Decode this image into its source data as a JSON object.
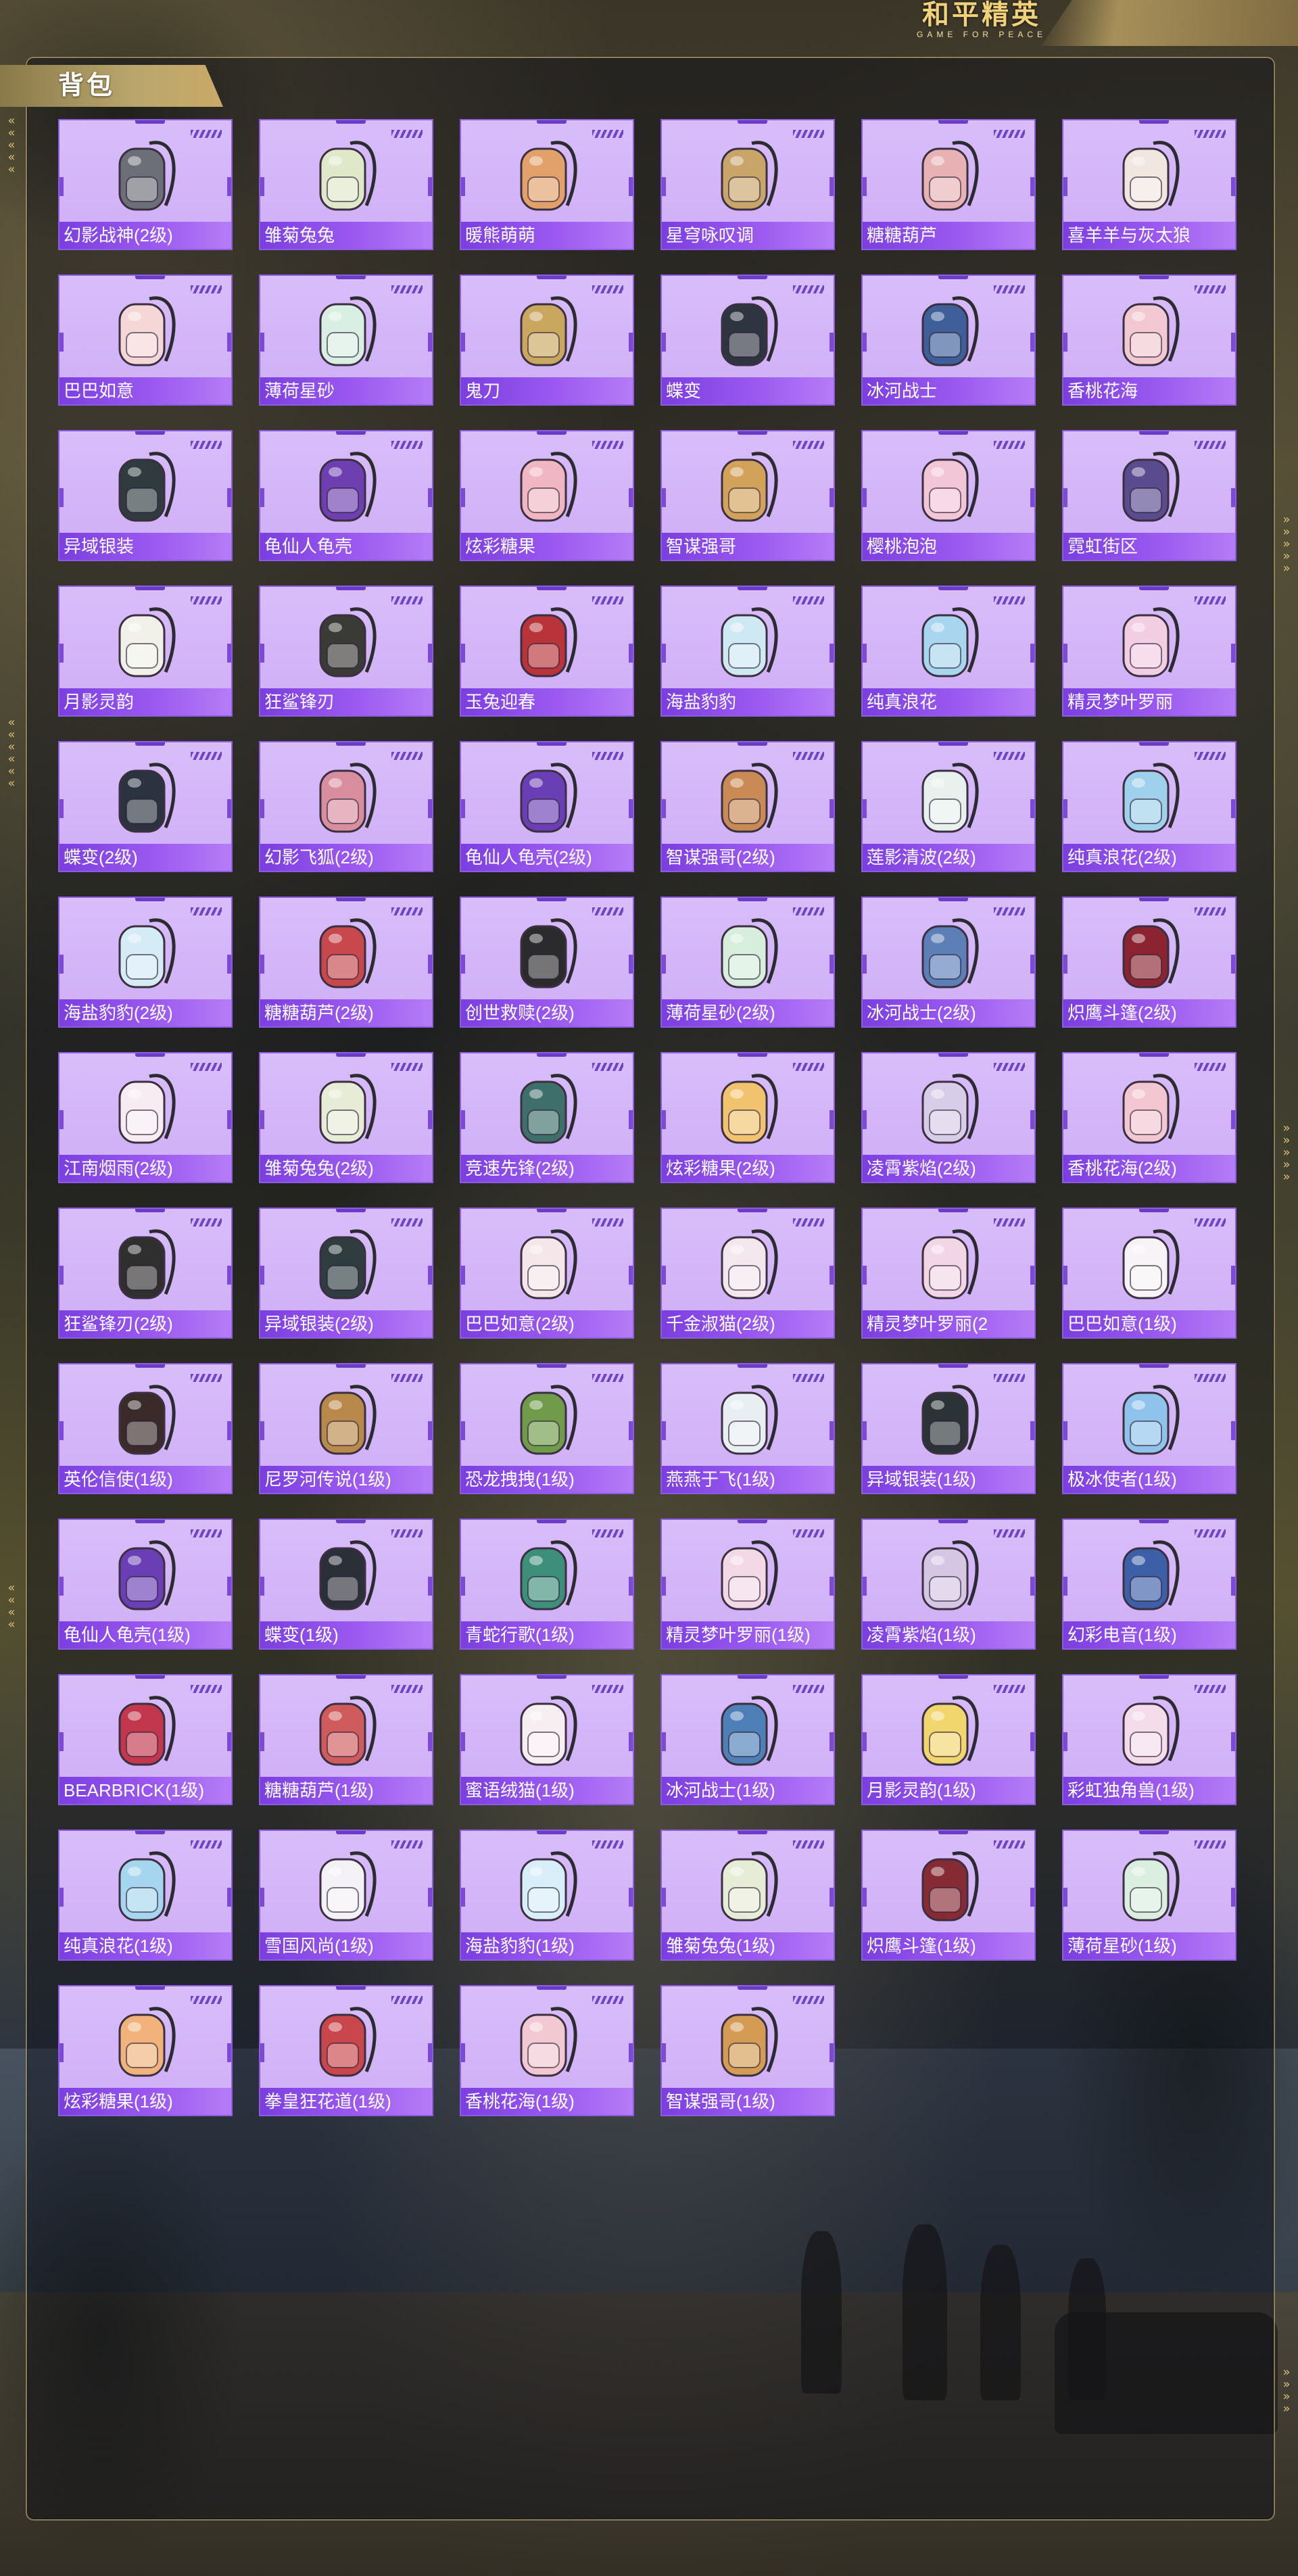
{
  "brand": {
    "title": "和平精英",
    "subtitle": "GAME FOR PEACE"
  },
  "panel": {
    "title": "背包"
  },
  "colors": {
    "card_bg": "#d8bdfa",
    "card_border": "#8c5de2",
    "label_bg": "#7b3fe0",
    "panel_frame": "#dcc88c"
  },
  "items": [
    {
      "name": "幻影战神(2级)",
      "color": "#6c6f78"
    },
    {
      "name": "雏菊兔兔",
      "color": "#dfe8c8"
    },
    {
      "name": "暖熊萌萌",
      "color": "#e2a06a"
    },
    {
      "name": "星穹咏叹调",
      "color": "#c9a56a"
    },
    {
      "name": "糖糖葫芦",
      "color": "#e8b2b4"
    },
    {
      "name": "喜羊羊与灰太狼",
      "color": "#f1e6e0"
    },
    {
      "name": "巴巴如意",
      "color": "#f6d7d8"
    },
    {
      "name": "薄荷星砂",
      "color": "#d9efe4"
    },
    {
      "name": "鬼刀",
      "color": "#c9a75e"
    },
    {
      "name": "蝶变",
      "color": "#2e3440"
    },
    {
      "name": "冰河战士",
      "color": "#3e5f9a"
    },
    {
      "name": "香桃花海",
      "color": "#f2c9d2"
    },
    {
      "name": "异域银装",
      "color": "#2f3b3e"
    },
    {
      "name": "龟仙人龟壳",
      "color": "#6d3fb0"
    },
    {
      "name": "炫彩糖果",
      "color": "#f0b7c3"
    },
    {
      "name": "智谋强哥",
      "color": "#d3a25a"
    },
    {
      "name": "樱桃泡泡",
      "color": "#f3c6d7"
    },
    {
      "name": "霓虹街区",
      "color": "#5a4b8f"
    },
    {
      "name": "月影灵韵",
      "color": "#f1f1ea"
    },
    {
      "name": "狂鲨锋刃",
      "color": "#3a3a36"
    },
    {
      "name": "玉兔迎春",
      "color": "#b8343a"
    },
    {
      "name": "海盐豹豹",
      "color": "#cfe9f4"
    },
    {
      "name": "纯真浪花",
      "color": "#a9d6ef"
    },
    {
      "name": "精灵梦叶罗丽",
      "color": "#f3cde2"
    },
    {
      "name": "蝶变(2级)",
      "color": "#2b3240"
    },
    {
      "name": "幻影飞狐(2级)",
      "color": "#d98ea0"
    },
    {
      "name": "龟仙人龟壳(2级)",
      "color": "#6a3fb5"
    },
    {
      "name": "智谋强哥(2级)",
      "color": "#c98a55"
    },
    {
      "name": "莲影清波(2级)",
      "color": "#e8f1ee"
    },
    {
      "name": "纯真浪花(2级)",
      "color": "#9fd1ec"
    },
    {
      "name": "海盐豹豹(2级)",
      "color": "#d5ecf7"
    },
    {
      "name": "糖糖葫芦(2级)",
      "color": "#c7484d"
    },
    {
      "name": "创世救赎(2级)",
      "color": "#2b2b2e"
    },
    {
      "name": "薄荷星砂(2级)",
      "color": "#d8eedd"
    },
    {
      "name": "冰河战士(2级)",
      "color": "#5c7fb8"
    },
    {
      "name": "炽鹰斗篷(2级)",
      "color": "#8b2430"
    },
    {
      "name": "江南烟雨(2级)",
      "color": "#f6ecf1"
    },
    {
      "name": "雏菊兔兔(2级)",
      "color": "#e7ecd6"
    },
    {
      "name": "竞速先锋(2级)",
      "color": "#3e6f6a"
    },
    {
      "name": "炫彩糖果(2级)",
      "color": "#f2c36f"
    },
    {
      "name": "凌霄紫焰(2级)",
      "color": "#d8cde8"
    },
    {
      "name": "香桃花海(2级)",
      "color": "#f3c7d1"
    },
    {
      "name": "狂鲨锋刃(2级)",
      "color": "#2f2f2f"
    },
    {
      "name": "异域银装(2级)",
      "color": "#2f3d40"
    },
    {
      "name": "巴巴如意(2级)",
      "color": "#f5e6ea"
    },
    {
      "name": "千金淑猫(2级)",
      "color": "#f4e7ee"
    },
    {
      "name": "精灵梦叶罗丽(2",
      "color": "#f2d6e6"
    },
    {
      "name": "巴巴如意(1级)",
      "color": "#f7f3f6"
    },
    {
      "name": "英伦信使(1级)",
      "color": "#3a2a2a"
    },
    {
      "name": "尼罗河传说(1级)",
      "color": "#b8894a"
    },
    {
      "name": "恐龙拽拽(1级)",
      "color": "#6f9b4a"
    },
    {
      "name": "燕燕于飞(1级)",
      "color": "#e9eef2"
    },
    {
      "name": "异域银装(1级)",
      "color": "#2c3336"
    },
    {
      "name": "极冰使者(1级)",
      "color": "#8fc3ec"
    },
    {
      "name": "龟仙人龟壳(1级)",
      "color": "#6a3fb5"
    },
    {
      "name": "蝶变(1级)",
      "color": "#2b2f38"
    },
    {
      "name": "青蛇行歌(1级)",
      "color": "#3e8f7a"
    },
    {
      "name": "精灵梦叶罗丽(1级)",
      "color": "#f3d9e6"
    },
    {
      "name": "凌霄紫焰(1级)",
      "color": "#d5c7e4"
    },
    {
      "name": "幻彩电音(1级)",
      "color": "#3c5fa8"
    },
    {
      "name": "BEARBRICK(1级)",
      "color": "#c2374d"
    },
    {
      "name": "糖糖葫芦(1级)",
      "color": "#cf5b5c"
    },
    {
      "name": "蜜语绒猫(1级)",
      "color": "#f7eef2"
    },
    {
      "name": "冰河战士(1级)",
      "color": "#4f7fb7"
    },
    {
      "name": "月影灵韵(1级)",
      "color": "#f1d66d"
    },
    {
      "name": "彩虹独角兽(1级)",
      "color": "#f4dceb"
    },
    {
      "name": "纯真浪花(1级)",
      "color": "#a6d6ef"
    },
    {
      "name": "雪国风尚(1级)",
      "color": "#f4f2f6"
    },
    {
      "name": "海盐豹豹(1级)",
      "color": "#d8eef8"
    },
    {
      "name": "雏菊兔兔(1级)",
      "color": "#e6ecd6"
    },
    {
      "name": "炽鹰斗篷(1级)",
      "color": "#862a34"
    },
    {
      "name": "薄荷星砂(1级)",
      "color": "#dbefe0"
    },
    {
      "name": "炫彩糖果(1级)",
      "color": "#f1b37b"
    },
    {
      "name": "拳皇狂花道(1级)",
      "color": "#c9464c"
    },
    {
      "name": "香桃花海(1级)",
      "color": "#f2c9d3"
    },
    {
      "name": "智谋强哥(1级)",
      "color": "#d49b54"
    }
  ]
}
